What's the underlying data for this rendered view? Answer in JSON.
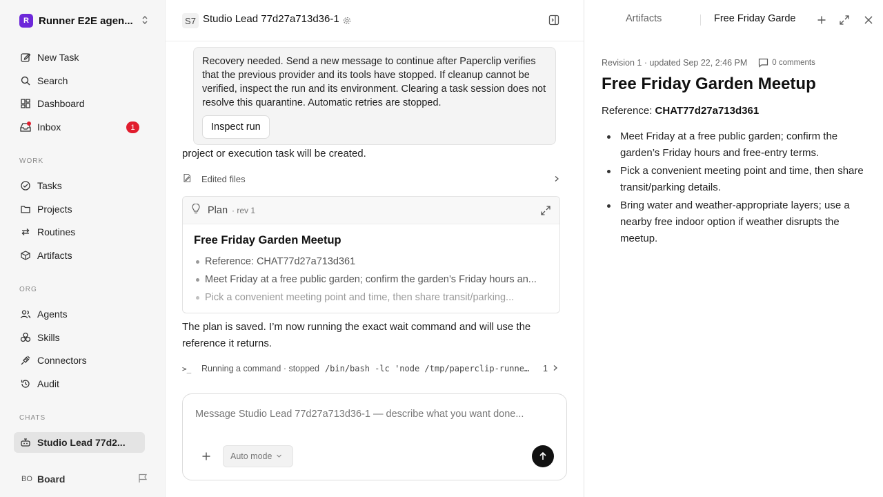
{
  "sidebar": {
    "workspace": {
      "logo": "R",
      "name": "Runner E2E agen..."
    },
    "primary": [
      {
        "label": "New Task",
        "icon": "pencil-square-icon"
      },
      {
        "label": "Search",
        "icon": "search-icon"
      },
      {
        "label": "Dashboard",
        "icon": "dashboard-icon"
      },
      {
        "label": "Inbox",
        "icon": "inbox-icon",
        "badge": "1"
      }
    ],
    "work_label": "WORK",
    "work": [
      {
        "label": "Tasks",
        "icon": "check-circle-icon"
      },
      {
        "label": "Projects",
        "icon": "folder-icon"
      },
      {
        "label": "Routines",
        "icon": "repeat-icon"
      },
      {
        "label": "Artifacts",
        "icon": "cube-icon"
      }
    ],
    "org_label": "ORG",
    "org": [
      {
        "label": "Agents",
        "icon": "users-icon"
      },
      {
        "label": "Skills",
        "icon": "boxes-icon"
      },
      {
        "label": "Connectors",
        "icon": "plug-icon"
      },
      {
        "label": "Audit",
        "icon": "history-icon"
      }
    ],
    "chats_label": "CHATS",
    "chats": [
      {
        "label": "Studio Lead 77d2...",
        "icon": "bot-icon"
      }
    ],
    "user": {
      "initials": "BO",
      "name": "Board"
    }
  },
  "chat": {
    "header": {
      "badge": "S7",
      "title": "Studio Lead 77d27a713d36-1"
    },
    "alert": {
      "text": "Recovery needed. Send a new message to continue after Paperclip verifies that the previous provider and its tools have stopped. If cleanup cannot be verified, inspect the run and its environment. Clearing a task session does not resolve this quarantine. Automatic retries are stopped.",
      "button": "Inspect run"
    },
    "partial_text": "project or execution task will be created.",
    "edited_files": "Edited files",
    "plan": {
      "label": "Plan",
      "rev": "· rev 1",
      "title": "Free Friday Garden Meetup",
      "items": [
        "Reference: CHAT77d27a713d361",
        "Meet Friday at a free public garden; confirm the garden’s Friday hours an...",
        "Pick a convenient meeting point and time, then share transit/parking..."
      ]
    },
    "saved_text": "The plan is saved. I’m now running the exact wait command and will use the reference it returns.",
    "command": {
      "status": "Running a command · stopped",
      "cmd": "/bin/bash -lc 'node /tmp/paperclip-runner...",
      "count": "1"
    },
    "composer": {
      "placeholder": "Message Studio Lead 77d27a713d36-1 — describe what you want done...",
      "mode": "Auto mode"
    }
  },
  "panel": {
    "tabs": [
      "Artifacts",
      "Free Friday Garde"
    ],
    "meta": "Revision 1 · updated Sep 22, 2:46 PM",
    "comments": "0 comments",
    "title": "Free Friday Garden Meetup",
    "ref_label": "Reference:",
    "ref_value": "CHAT77d27a713d361",
    "items": [
      "Meet Friday at a free public garden; confirm the garden’s Friday hours and free-entry terms.",
      "Pick a convenient meeting point and time, then share transit/parking details.",
      "Bring water and weather-appropriate layers; use a nearby free indoor option if weather disrupts the meetup."
    ]
  }
}
